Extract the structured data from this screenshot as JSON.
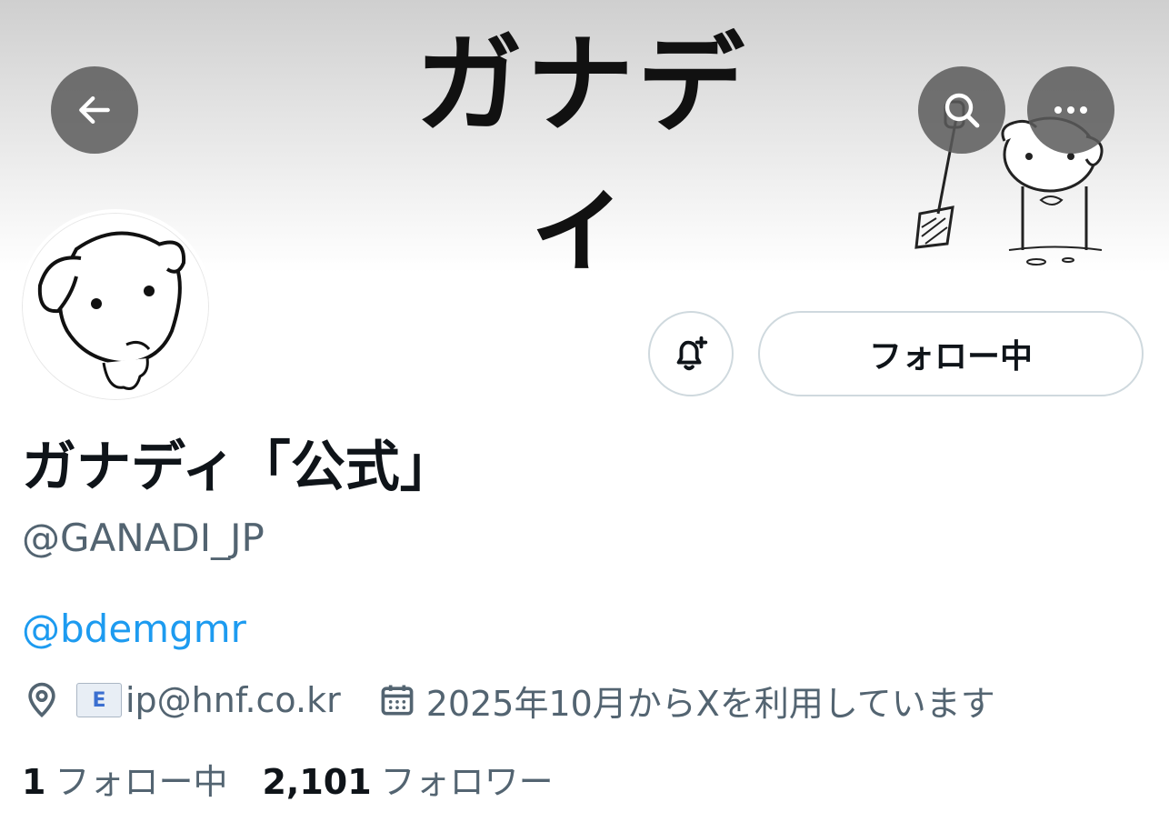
{
  "banner": {
    "title_text": "ガナディ"
  },
  "header_buttons": {
    "back_icon": "arrow-left-icon",
    "search_icon": "search-icon",
    "more_icon": "more-horizontal-icon"
  },
  "profile": {
    "display_name": "ガナディ「公式」",
    "handle": "@GANADI_JP",
    "bio_link": "@bdemgmr",
    "location_icon": "location-pin-icon",
    "email_emoji_label": "E",
    "location_text": "ip@hnf.co.kr",
    "calendar_icon": "calendar-icon",
    "joined_text": "2025年10月からXを利用しています"
  },
  "actions": {
    "notify_icon": "bell-plus-icon",
    "follow_label": "フォロー中"
  },
  "stats": {
    "following_count": "1",
    "following_label": "フォロー中",
    "followers_count": "2,101",
    "followers_label": "フォロワー"
  },
  "colors": {
    "link": "#1d9bf0",
    "secondary_text": "#536471",
    "border": "#cfd9de"
  }
}
